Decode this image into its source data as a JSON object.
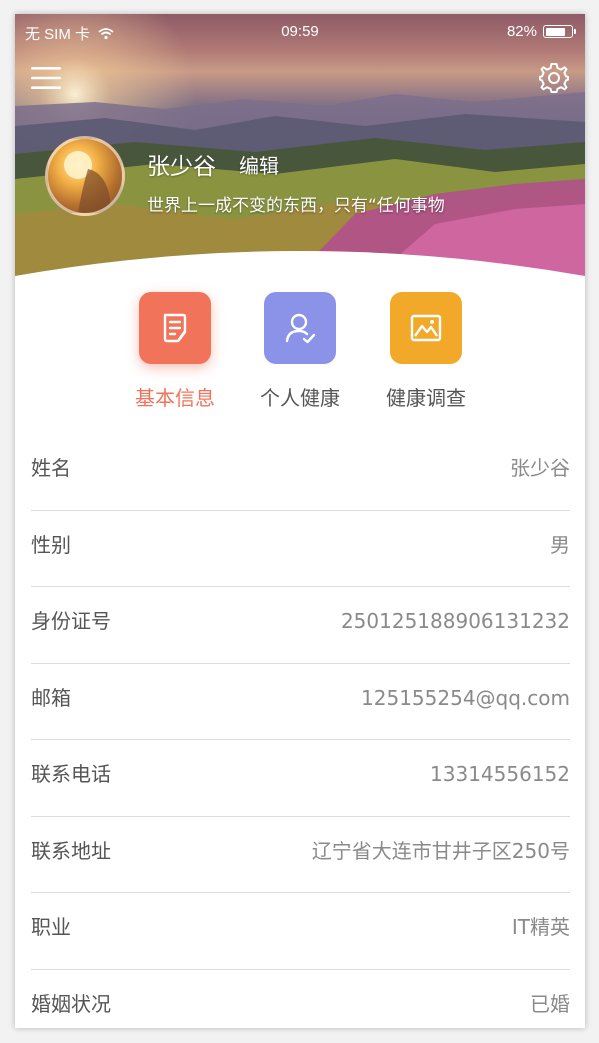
{
  "status_bar": {
    "carrier": "无 SIM 卡",
    "wifi_icon": "wifi-icon",
    "time": "09:59",
    "battery_text": "82%",
    "battery_level": 0.82
  },
  "header": {
    "menu_icon": "hamburger-menu-icon",
    "settings_icon": "gear-icon",
    "user_name": "张少谷",
    "edit_label": "编辑",
    "motto": "世界上一成不变的东西，只有“任何事物"
  },
  "tabs": [
    {
      "label": "基本信息",
      "icon": "document-edit-icon",
      "color": "#f0735a",
      "active": true
    },
    {
      "label": "个人健康",
      "icon": "user-check-icon",
      "color": "#8b93e8",
      "active": false
    },
    {
      "label": "健康调查",
      "icon": "image-icon",
      "color": "#f2a92a",
      "active": false
    }
  ],
  "info_rows": [
    {
      "key": "姓名",
      "value": "张少谷"
    },
    {
      "key": "性别",
      "value": "男"
    },
    {
      "key": "身份证号",
      "value": "250125188906131232"
    },
    {
      "key": "邮箱",
      "value": "125155254@qq.com"
    },
    {
      "key": "联系电话",
      "value": "13314556152"
    },
    {
      "key": "联系地址",
      "value": "辽宁省大连市甘井子区250号"
    },
    {
      "key": "职业",
      "value": "IT精英"
    },
    {
      "key": "婚姻状况",
      "value": "已婚"
    }
  ],
  "colors": {
    "accent": "#f0735a",
    "text_primary": "#555555",
    "text_secondary": "#8a8a8a",
    "divider": "#dddddd"
  }
}
